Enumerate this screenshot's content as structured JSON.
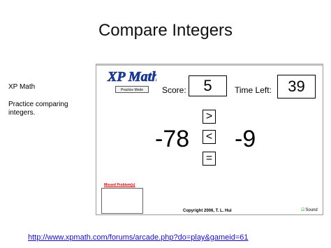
{
  "slide": {
    "title": "Compare Integers",
    "sidebar_title": "XP Math",
    "sidebar_description": "Practice comparing integers.",
    "link_text": "http://www.xpmath.com/forums/arcade.php?do=play&gameid=61"
  },
  "applet": {
    "logo_text": "XP Math",
    "mode_button": "Practice Mode",
    "score_label": "Score:",
    "score_value": "5",
    "time_label": "Time Left:",
    "time_value": "39",
    "left_number": "-78",
    "right_number": "-9",
    "operators": {
      "greater": ">",
      "less": "<",
      "equal": "="
    },
    "missed_label": "Missed Problem(s)",
    "copyright": "Copyright 2006, T. L. Hui",
    "sound_label": "Sound",
    "logo_color": "#1a3fa6"
  }
}
